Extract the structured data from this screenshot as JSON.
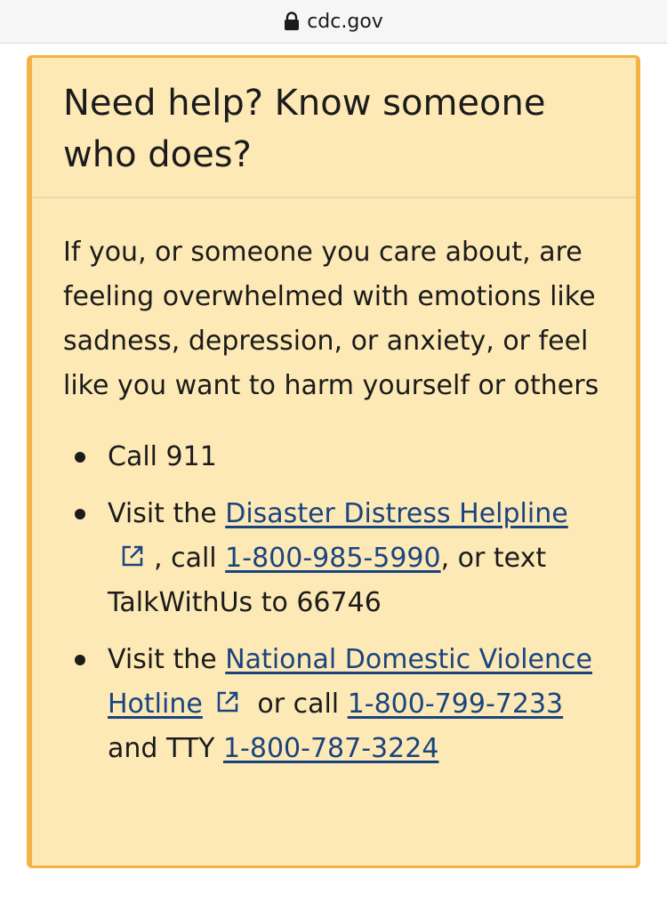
{
  "browser": {
    "url": "cdc.gov",
    "lock_icon": "lock-icon"
  },
  "card": {
    "title": "Need help? Know someone who does?",
    "intro": "If you, or someone you care about, are feeling overwhelmed with emotions like sadness, depression, or anxiety, or feel like you want to harm yourself or others",
    "items": [
      {
        "text": "Call 911"
      },
      {
        "prefix": "Visit the ",
        "link": "Disaster Distress Helpline",
        "external_icon": "external-link-icon",
        "middle": ", call ",
        "phone": "1-800-985-5990",
        "suffix": ", or text TalkWithUs to 66746"
      },
      {
        "prefix": "Visit the ",
        "link": "National Domestic Violence Hotline",
        "external_icon": "external-link-icon",
        "middle": " or call ",
        "phone": "1-800-799-7233",
        "tty_label": " and TTY ",
        "tty_phone": "1-800-787-3224"
      }
    ]
  },
  "colors": {
    "card_background": "#fce9b5",
    "card_border": "#f5b244",
    "link": "#1a4480",
    "text": "#1b1b1b"
  }
}
